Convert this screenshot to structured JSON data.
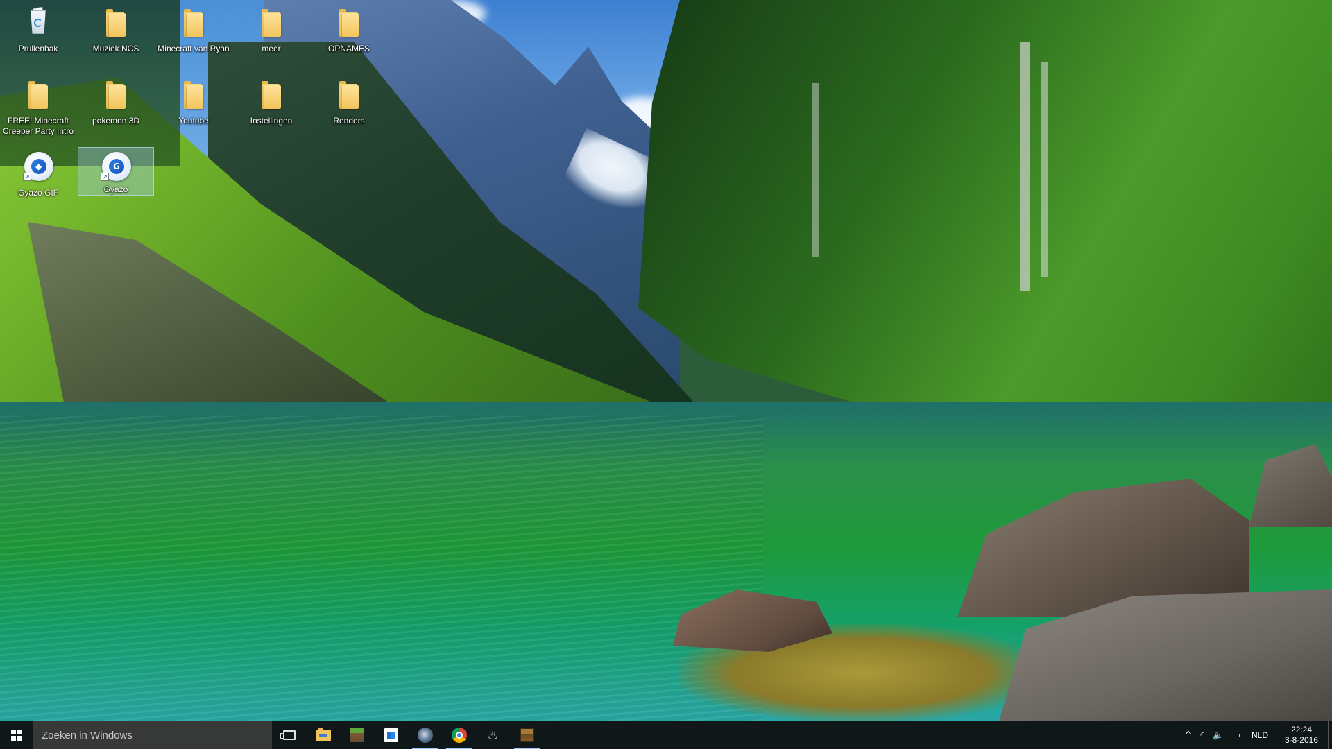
{
  "desktop": {
    "icons": [
      {
        "label": "Prullenbak",
        "icon": "recycle-bin-icon"
      },
      {
        "label": "Muziek NCS",
        "icon": "folder-icon"
      },
      {
        "label": "Minecraft van Ryan",
        "icon": "folder-icon"
      },
      {
        "label": "meer",
        "icon": "folder-icon"
      },
      {
        "label": "OPNAMES",
        "icon": "folder-icon"
      },
      {
        "label": "FREE! Minecraft Creeper Party Intro",
        "icon": "folder-icon"
      },
      {
        "label": "pokemon 3D",
        "icon": "folder-icon"
      },
      {
        "label": "Youtube",
        "icon": "folder-icon"
      },
      {
        "label": "Instellingen",
        "icon": "folder-icon"
      },
      {
        "label": "Renders",
        "icon": "folder-icon"
      },
      {
        "label": "Gyazo GIF",
        "icon": "gyazo-gif-icon"
      },
      {
        "label": "Gyazo",
        "icon": "gyazo-icon",
        "selected": true
      }
    ]
  },
  "taskbar": {
    "search_placeholder": "Zoeken in Windows",
    "pinned": [
      {
        "name": "task-view",
        "icon": "task-view-icon"
      },
      {
        "name": "file-explorer",
        "icon": "folder-icon"
      },
      {
        "name": "minecraft",
        "icon": "minecraft-block-icon"
      },
      {
        "name": "store",
        "icon": "store-icon"
      },
      {
        "name": "steam",
        "icon": "steam-icon",
        "running": true
      },
      {
        "name": "chrome",
        "icon": "chrome-icon",
        "running": true
      },
      {
        "name": "java",
        "icon": "java-icon"
      },
      {
        "name": "minecraft-chest",
        "icon": "chest-icon",
        "running": true
      }
    ],
    "tray": {
      "chevron": "^",
      "language": "NLD",
      "time": "22:24",
      "date": "3-8-2016"
    }
  },
  "colors": {
    "taskbar": "#101418",
    "search_box": "#3c3c3c",
    "running_indicator": "#9dc9ff",
    "folder": "#f2c55c"
  }
}
